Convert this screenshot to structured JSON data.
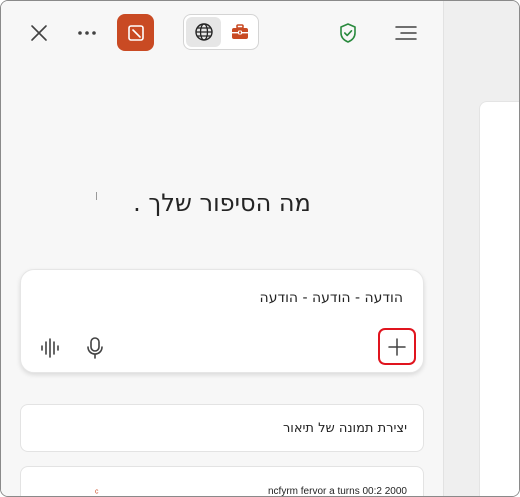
{
  "toolbar": {
    "close_icon": "close-icon",
    "more_icon": "more-horizontal-icon",
    "app_icon": "copilot-app-icon",
    "app_color": "#c94a23",
    "web_icon": "globe-icon",
    "work_icon": "briefcase-icon",
    "work_color": "#c94a23",
    "shield_icon": "shield-check-icon",
    "shield_color": "#2a8a3e",
    "menu_icon": "menu-icon",
    "selected_mode": "web"
  },
  "main": {
    "heading": "מה הסיפור שלך ."
  },
  "composer": {
    "message": "הודעה - הודעה - הודעה",
    "wave_icon": "voice-wave-icon",
    "mic_icon": "microphone-icon",
    "plus_icon": "plus-icon",
    "highlight_color": "#e0141e"
  },
  "suggestions": [
    {
      "label": "יצירת תמונה של תיאור"
    },
    {
      "label": "ncfyrm fervor a turns 00:2 2000"
    }
  ]
}
